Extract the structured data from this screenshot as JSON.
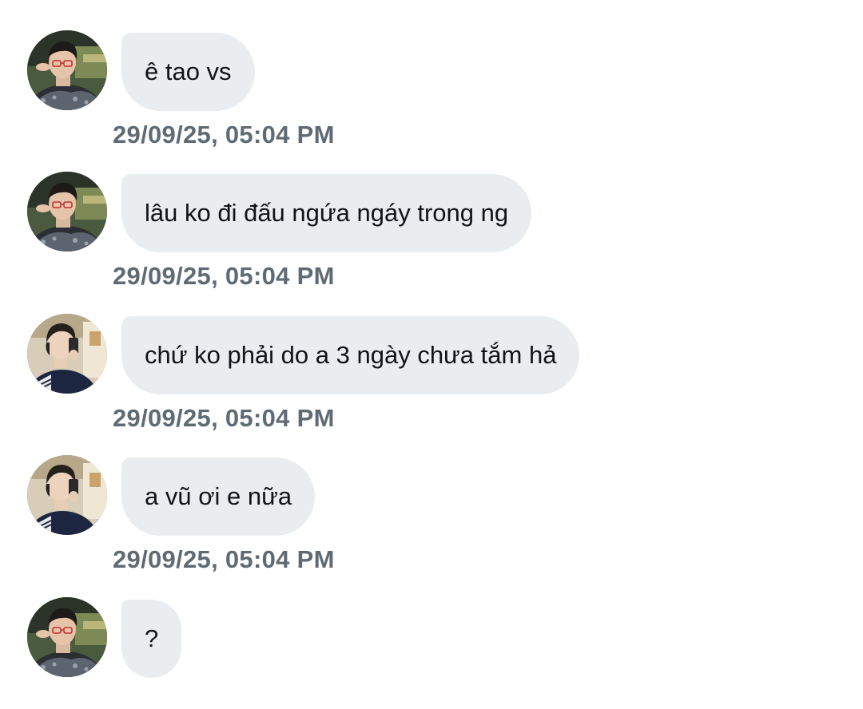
{
  "messages": [
    {
      "sender_avatar": "avatar-male-glasses",
      "text": "ê tao vs",
      "timestamp": "29/09/25, 05:04 PM"
    },
    {
      "sender_avatar": "avatar-male-glasses",
      "text": "lâu ko đi đấu ngứa ngáy trong ng",
      "timestamp": "29/09/25, 05:04 PM"
    },
    {
      "sender_avatar": "avatar-mirror-selfie",
      "text": "chứ ko phải do a 3 ngày chưa tắm hả",
      "timestamp": "29/09/25, 05:04 PM"
    },
    {
      "sender_avatar": "avatar-mirror-selfie",
      "text": "a vũ ơi e nữa",
      "timestamp": "29/09/25, 05:04 PM"
    },
    {
      "sender_avatar": "avatar-male-glasses",
      "text": "?",
      "timestamp": ""
    }
  ],
  "colors": {
    "bubble_bg": "#e9edf0",
    "message_text": "#101418",
    "timestamp_text": "#5f6b74",
    "background": "#ffffff"
  }
}
